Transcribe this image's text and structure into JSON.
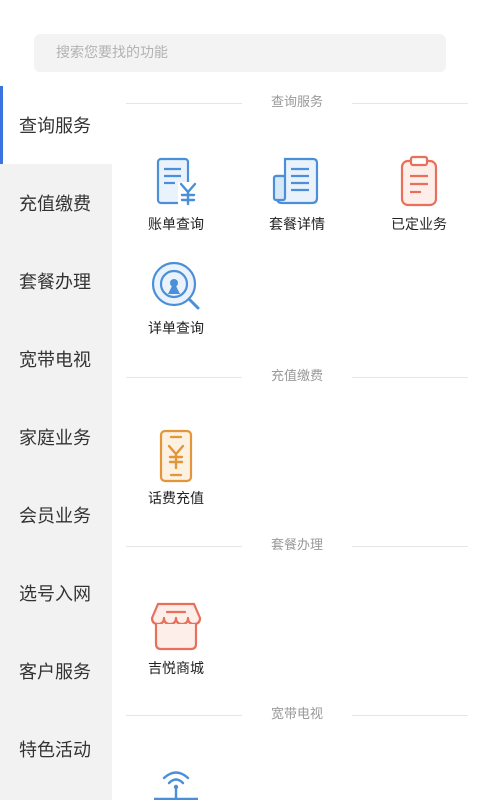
{
  "search": {
    "placeholder": "搜索您要找的功能"
  },
  "sidebar": {
    "items": [
      {
        "label": "查询服务",
        "active": true
      },
      {
        "label": "充值缴费"
      },
      {
        "label": "套餐办理"
      },
      {
        "label": "宽带电视"
      },
      {
        "label": "家庭业务"
      },
      {
        "label": "会员业务"
      },
      {
        "label": "选号入网"
      },
      {
        "label": "客户服务"
      },
      {
        "label": "特色活动"
      }
    ]
  },
  "sections": [
    {
      "title": "查询服务",
      "items": [
        {
          "label": "账单查询",
          "icon": "bill-icon"
        },
        {
          "label": "套餐详情",
          "icon": "document-icon"
        },
        {
          "label": "已定业务",
          "icon": "clipboard-icon"
        },
        {
          "label": "详单查询",
          "icon": "magnifier-icon"
        }
      ]
    },
    {
      "title": "充值缴费",
      "items": [
        {
          "label": "话费充值",
          "icon": "phone-yuan-icon"
        }
      ]
    },
    {
      "title": "套餐办理",
      "items": [
        {
          "label": "吉悦商城",
          "icon": "shop-icon"
        }
      ]
    },
    {
      "title": "宽带电视",
      "items": []
    }
  ],
  "colors": {
    "accent": "#3b73e0",
    "blue_icon": "#4a8fd8",
    "red_icon": "#e8705a",
    "orange_icon": "#e3953a"
  }
}
